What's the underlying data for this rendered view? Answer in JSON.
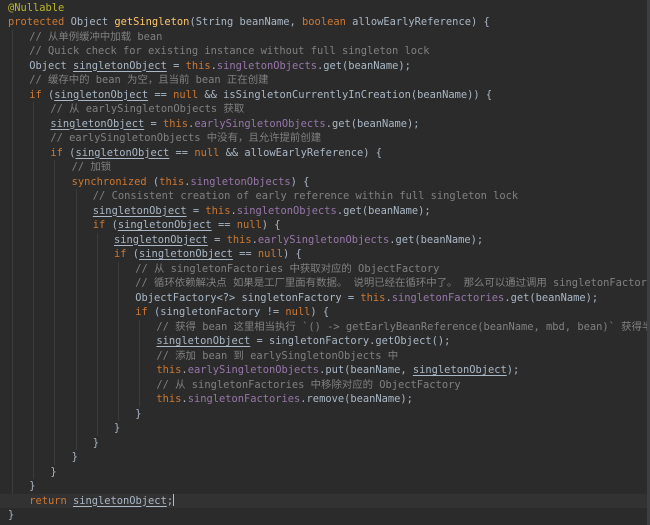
{
  "editor": {
    "language": "java",
    "colors": {
      "background": "#2b2b2b",
      "keyword": "#cc7832",
      "annotation": "#bbb529",
      "field": "#9876aa",
      "method": "#ffc66d",
      "comment": "#808080",
      "text": "#a9b7c6"
    },
    "lines": [
      [
        [
          "annot",
          "@Nullable"
        ]
      ],
      [
        [
          "kw",
          "protected "
        ],
        [
          "plain",
          "Object "
        ],
        [
          "method",
          "getSingleton"
        ],
        [
          "plain",
          "(String beanName, "
        ],
        [
          "kw",
          "boolean "
        ],
        [
          "plain",
          "allowEarlyReference) {"
        ]
      ],
      [
        [
          "comment",
          "// 从单例缓冲中加载 bean"
        ]
      ],
      [
        [
          "comment",
          "// Quick check for existing instance without full singleton lock"
        ]
      ],
      [
        [
          "plain",
          "Object "
        ],
        [
          "var",
          "singletonObject"
        ],
        [
          "plain",
          " = "
        ],
        [
          "kw",
          "this"
        ],
        [
          "plain",
          "."
        ],
        [
          "field",
          "singletonObjects"
        ],
        [
          "plain",
          ".get(beanName);"
        ]
      ],
      [
        [
          "comment",
          "// 缓存中的 bean 为空，且当前 bean 正在创建"
        ]
      ],
      [
        [
          "kw",
          "if "
        ],
        [
          "plain",
          "("
        ],
        [
          "var",
          "singletonObject"
        ],
        [
          "plain",
          " == "
        ],
        [
          "kw",
          "null "
        ],
        [
          "plain",
          "&& isSingletonCurrentlyInCreation(beanName)) {"
        ]
      ],
      [
        [
          "comment",
          "// 从 earlySingletonObjects 获取"
        ]
      ],
      [
        [
          "var",
          "singletonObject"
        ],
        [
          "plain",
          " = "
        ],
        [
          "kw",
          "this"
        ],
        [
          "plain",
          "."
        ],
        [
          "field",
          "earlySingletonObjects"
        ],
        [
          "plain",
          ".get(beanName);"
        ]
      ],
      [
        [
          "comment",
          "// earlySingletonObjects 中没有，且允许提前创建"
        ]
      ],
      [
        [
          "kw",
          "if "
        ],
        [
          "plain",
          "("
        ],
        [
          "var",
          "singletonObject"
        ],
        [
          "plain",
          " == "
        ],
        [
          "kw",
          "null "
        ],
        [
          "plain",
          "&& allowEarlyReference) {"
        ]
      ],
      [
        [
          "comment",
          "// 加锁"
        ]
      ],
      [
        [
          "kw",
          "synchronized "
        ],
        [
          "plain",
          "("
        ],
        [
          "kw",
          "this"
        ],
        [
          "plain",
          "."
        ],
        [
          "field",
          "singletonObjects"
        ],
        [
          "plain",
          ") {"
        ]
      ],
      [
        [
          "comment",
          "// Consistent creation of early reference within full singleton lock"
        ]
      ],
      [
        [
          "var",
          "singletonObject"
        ],
        [
          "plain",
          " = "
        ],
        [
          "kw",
          "this"
        ],
        [
          "plain",
          "."
        ],
        [
          "field",
          "singletonObjects"
        ],
        [
          "plain",
          ".get(beanName);"
        ]
      ],
      [
        [
          "kw",
          "if "
        ],
        [
          "plain",
          "("
        ],
        [
          "var",
          "singletonObject"
        ],
        [
          "plain",
          " == "
        ],
        [
          "kw",
          "null"
        ],
        [
          "plain",
          ") {"
        ]
      ],
      [
        [
          "var",
          "singletonObject"
        ],
        [
          "plain",
          " = "
        ],
        [
          "kw",
          "this"
        ],
        [
          "plain",
          "."
        ],
        [
          "field",
          "earlySingletonObjects"
        ],
        [
          "plain",
          ".get(beanName);"
        ]
      ],
      [
        [
          "kw",
          "if "
        ],
        [
          "plain",
          "("
        ],
        [
          "var",
          "singletonObject"
        ],
        [
          "plain",
          " == "
        ],
        [
          "kw",
          "null"
        ],
        [
          "plain",
          ") {"
        ]
      ],
      [
        [
          "comment",
          "// 从 singletonFactories 中获取对应的 ObjectFactory"
        ]
      ],
      [
        [
          "comment",
          "// 循环依赖解决点 如果是工厂里面有数据。 说明已经在循环中了。 那么可以通过调用 singletonFactory.getObject"
        ]
      ],
      [
        [
          "plain",
          "ObjectFactory<?> singletonFactory = "
        ],
        [
          "kw",
          "this"
        ],
        [
          "plain",
          "."
        ],
        [
          "field",
          "singletonFactories"
        ],
        [
          "plain",
          ".get(beanName);"
        ]
      ],
      [
        [
          "kw",
          "if "
        ],
        [
          "plain",
          "(singletonFactory != "
        ],
        [
          "kw",
          "null"
        ],
        [
          "plain",
          ") {"
        ]
      ],
      [
        [
          "comment",
          "// 获得 bean 这里相当执行 `() -> getEarlyBeanReference(beanName, mbd, bean)` 获得半成品bean"
        ]
      ],
      [
        [
          "var",
          "singletonObject"
        ],
        [
          "plain",
          " = singletonFactory.getObject();"
        ]
      ],
      [
        [
          "comment",
          "// 添加 bean 到 earlySingletonObjects 中"
        ]
      ],
      [
        [
          "kw",
          "this"
        ],
        [
          "plain",
          "."
        ],
        [
          "field",
          "earlySingletonObjects"
        ],
        [
          "plain",
          ".put(beanName, "
        ],
        [
          "var",
          "singletonObject"
        ],
        [
          "plain",
          ");"
        ]
      ],
      [
        [
          "comment",
          "// 从 singletonFactories 中移除对应的 ObjectFactory"
        ]
      ],
      [
        [
          "kw",
          "this"
        ],
        [
          "plain",
          "."
        ],
        [
          "field",
          "singletonFactories"
        ],
        [
          "plain",
          ".remove(beanName);"
        ]
      ],
      [
        [
          "plain",
          "}"
        ]
      ],
      [
        [
          "plain",
          "}"
        ]
      ],
      [
        [
          "plain",
          "}"
        ]
      ],
      [
        [
          "plain",
          "}"
        ]
      ],
      [
        [
          "plain",
          "}"
        ]
      ],
      [
        [
          "plain",
          "}"
        ]
      ],
      [
        [
          "kw",
          "return "
        ],
        [
          "var",
          "singletonObject"
        ],
        [
          "plain",
          ";"
        ]
      ],
      [
        [
          "plain",
          "}"
        ]
      ]
    ]
  }
}
